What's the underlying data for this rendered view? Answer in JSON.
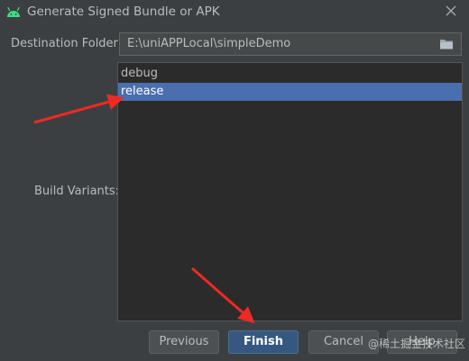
{
  "window": {
    "title": "Generate Signed Bundle or APK",
    "icon": "android-icon",
    "close_icon": "close-icon"
  },
  "destination": {
    "label": "Destination Folder:",
    "value": "E:\\uniAPPLocal\\simpleDemo",
    "browse_icon": "folder-icon"
  },
  "build_variants": {
    "label": "Build Variants:",
    "items": [
      {
        "label": "debug",
        "selected": false
      },
      {
        "label": "release",
        "selected": true
      }
    ]
  },
  "buttons": {
    "previous": "Previous",
    "finish": "Finish",
    "cancel": "Cancel",
    "help": "Help"
  },
  "watermark": "@稀土掘金技术社区",
  "colors": {
    "background": "#3c3f41",
    "selection": "#4b6eaf",
    "default_button": "#365880",
    "annotation_arrow": "#ee2a24"
  }
}
